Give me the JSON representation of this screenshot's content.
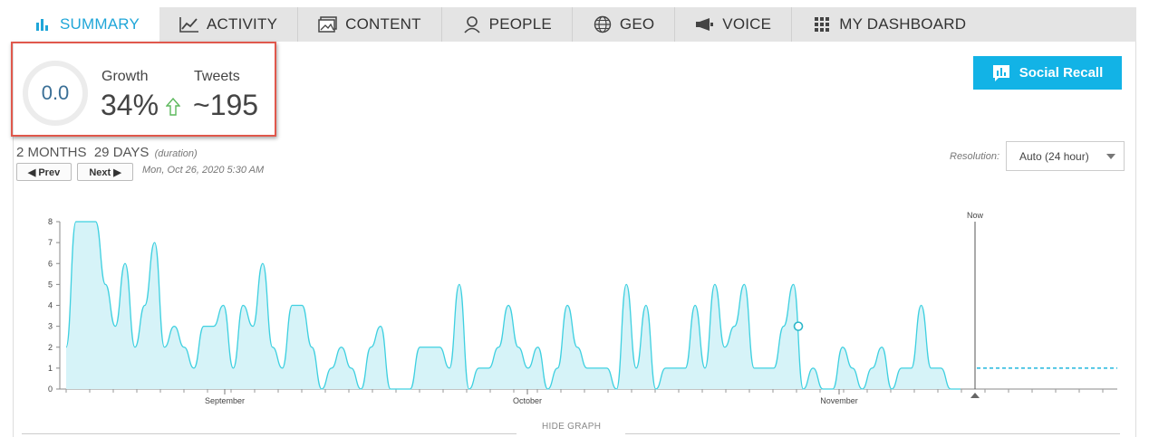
{
  "tabs": [
    {
      "label": "SUMMARY",
      "icon": "bar-chart-icon",
      "active": true
    },
    {
      "label": "ACTIVITY",
      "icon": "line-trend-icon"
    },
    {
      "label": "CONTENT",
      "icon": "image-icon"
    },
    {
      "label": "PEOPLE",
      "icon": "person-icon"
    },
    {
      "label": "GEO",
      "icon": "globe-icon"
    },
    {
      "label": "VOICE",
      "icon": "megaphone-icon"
    },
    {
      "label": "MY DASHBOARD",
      "icon": "grid-icon"
    }
  ],
  "metrics": {
    "score": "0.0",
    "growth_label": "Growth",
    "growth_value": "34%",
    "tweets_label": "Tweets",
    "tweets_value": "~195"
  },
  "social_recall_label": "Social Recall",
  "duration": {
    "text": "2 MONTHS  29 DAYS",
    "sub": "(duration)",
    "prev_label": "◀ Prev",
    "next_label": "Next ▶",
    "timestamp": "Mon, Oct 26, 2020 5:30 AM"
  },
  "resolution": {
    "label": "Resolution:",
    "value": "Auto (24 hour)"
  },
  "hide_graph_label": "HIDE GRAPH",
  "colors": {
    "accent": "#1fa6d8",
    "series_line": "#3fd0e0",
    "series_fill": "#d6f3f8",
    "highlight_border": "#e0584c"
  },
  "chart_data": {
    "type": "area",
    "ylim": [
      0,
      8
    ],
    "yticks": [
      0,
      1,
      2,
      3,
      4,
      5,
      6,
      7,
      8
    ],
    "x_tick_labels": [
      "September",
      "October",
      "November"
    ],
    "now_label": "Now",
    "series": [
      {
        "values": [
          2,
          8,
          8,
          8,
          5,
          3,
          6,
          2,
          4,
          7,
          2,
          3,
          2,
          1,
          3,
          3,
          4,
          1,
          4,
          3,
          6,
          2,
          1,
          4,
          4,
          2,
          0,
          1,
          2,
          1,
          0,
          2,
          3,
          0,
          0,
          0,
          2,
          2,
          2,
          1,
          5,
          0,
          1,
          1,
          2,
          4,
          2,
          1,
          2,
          0,
          1,
          4,
          2,
          1,
          1,
          1,
          0,
          5,
          1,
          4,
          0,
          1,
          1,
          1,
          4,
          1,
          5,
          2,
          3,
          5,
          1,
          1,
          1,
          3,
          5,
          0,
          1,
          0,
          0,
          2,
          1,
          0,
          1,
          2,
          0,
          1,
          1,
          4,
          1,
          1,
          0,
          0
        ]
      },
      {
        "values": [
          1,
          1
        ]
      }
    ]
  }
}
